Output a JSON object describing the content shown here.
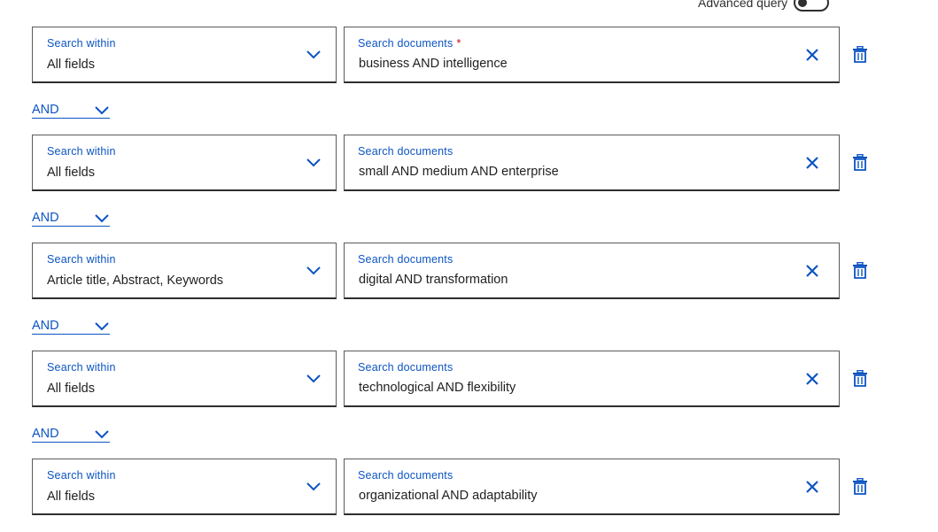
{
  "advanced_query": {
    "label": "Advanced query",
    "enabled": false
  },
  "search_within_label": "Search within",
  "search_docs_label": "Search documents",
  "required_mark": "*",
  "rows": [
    {
      "search_within": "All fields",
      "query": "business AND intelligence",
      "required": true
    },
    {
      "search_within": "All fields",
      "query": "small AND medium AND enterprise",
      "required": false
    },
    {
      "search_within": "Article title, Abstract, Keywords",
      "query": "digital AND transformation",
      "required": false
    },
    {
      "search_within": "All fields",
      "query": "technological AND flexibility",
      "required": false
    },
    {
      "search_within": "All fields",
      "query": "organizational AND adaptability",
      "required": false
    }
  ],
  "operators": [
    "AND",
    "AND",
    "AND",
    "AND"
  ],
  "colors": {
    "accent": "#0c54c2",
    "text": "#1f1f1f",
    "required": "#d0021b",
    "border": "#2e2e2e"
  },
  "icons": {
    "dropdown": "chevron-down-icon",
    "clear": "close-icon",
    "delete": "trash-icon"
  }
}
